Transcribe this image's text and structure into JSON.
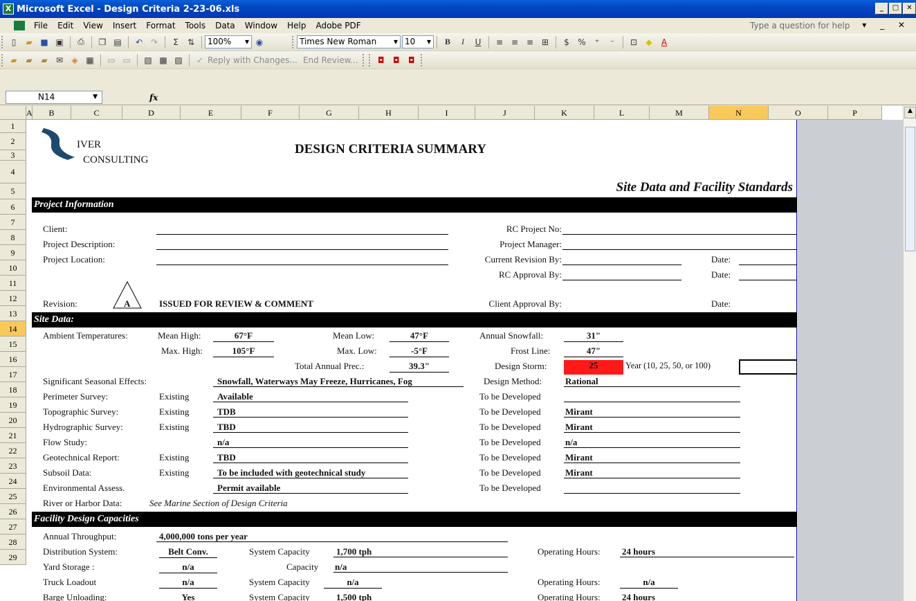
{
  "window": {
    "title": "Microsoft Excel - Design Criteria 2-23-06.xls",
    "buttons": [
      "_",
      "□",
      "✕"
    ]
  },
  "menu": {
    "items": [
      "File",
      "Edit",
      "View",
      "Insert",
      "Format",
      "Tools",
      "Data",
      "Window",
      "Help",
      "Adobe PDF"
    ],
    "ask_placeholder": "Type a question for help"
  },
  "toolbar": {
    "zoom": "100%",
    "font": "Times New Roman",
    "font_size": "10",
    "review": "Reply with Changes...",
    "end_review": "End Review..."
  },
  "formula_bar": {
    "cell_ref": "N14",
    "fx": "fx",
    "content": ""
  },
  "columns": [
    "A",
    "B",
    "C",
    "D",
    "E",
    "F",
    "G",
    "H",
    "I",
    "J",
    "K",
    "L",
    "M",
    "N",
    "O",
    "P"
  ],
  "rows": [
    "1",
    "2",
    "3",
    "4",
    "5",
    "6",
    "7",
    "8",
    "9",
    "10",
    "11",
    "12",
    "13",
    "14",
    "15",
    "16",
    "17",
    "18",
    "19",
    "20",
    "21",
    "22",
    "23",
    "24",
    "25",
    "26",
    "27",
    "28",
    "29"
  ],
  "sheet": {
    "logo": {
      "line1": "IVER",
      "line2": "CONSULTING"
    },
    "title": "DESIGN CRITERIA SUMMARY",
    "subtitle": "Site Data and Facility Standards",
    "sections": {
      "project": "Project Information",
      "site": "Site Data:",
      "facility": "Facility Design Capacities"
    },
    "project": {
      "client": "Client:",
      "description": "Project Description:",
      "location": "Project Location:",
      "revision_label": "Revision:",
      "revision_value": "A",
      "revision_text": "ISSUED FOR REVIEW & COMMENT",
      "rc_project_no": "RC Project No:",
      "project_manager": "Project Manager:",
      "current_revision_by": "Current Revision By:",
      "rc_approval_by": "RC Approval By:",
      "client_approval_by": "Client Approval By:",
      "date": "Date:"
    },
    "site": {
      "ambient": "Ambient Temperatures:",
      "mean_high_label": "Mean High:",
      "mean_high": "67°F",
      "max_high_label": "Max. High:",
      "max_high": "105°F",
      "mean_low_label": "Mean Low:",
      "mean_low": "47°F",
      "max_low_label": "Max. Low:",
      "max_low": "-5°F",
      "total_prec_label": "Total Annual Prec.:",
      "total_prec": "39.3\"",
      "snowfall_label": "Annual Snowfall:",
      "snowfall": "31\"",
      "frost_label": "Frost Line:",
      "frost": "47\"",
      "storm_label": "Design Storm:",
      "storm": "25",
      "storm_note": "Year (10, 25, 50, or 100)",
      "seasonal_label": "Significant Seasonal Effects:",
      "seasonal": "Snowfall, Waterways May Freeze, Hurricanes, Fog",
      "method_label": "Design Method:",
      "method": "Rational",
      "surveys": [
        {
          "label": "Perimeter Survey:",
          "status": "Existing",
          "value": "Available",
          "dev": "To be Developed",
          "dev_value": ""
        },
        {
          "label": "Topographic Survey:",
          "status": "Existing",
          "value": "TDB",
          "dev": "To be Developed",
          "dev_value": "Mirant"
        },
        {
          "label": "Hydrographic Survey:",
          "status": "Existing",
          "value": "TBD",
          "dev": "To be Developed",
          "dev_value": "Mirant"
        },
        {
          "label": "Flow Study:",
          "status": "",
          "value": "n/a",
          "dev": "To be Developed",
          "dev_value": "n/a"
        },
        {
          "label": "Geotechnical Report:",
          "status": "Existing",
          "value": "TBD",
          "dev": "To be Developed",
          "dev_value": "Mirant"
        },
        {
          "label": "Subsoil Data:",
          "status": "Existing",
          "value": "To be included with geotechnical study",
          "dev": "To be Developed",
          "dev_value": "Mirant"
        },
        {
          "label": "Environmental Assess.",
          "status": "",
          "value": "Permit available",
          "dev": "To be Developed",
          "dev_value": ""
        }
      ],
      "river_label": "River or Harbor Data:",
      "river": "See Marine Section of Design Criteria"
    },
    "facility": {
      "throughput_label": "Annual Throughput:",
      "throughput": "4,000,000 tons per year",
      "dist_label": "Distribution System:",
      "dist": "Belt Conv.",
      "sys_cap_label": "System Capacity",
      "sys_cap": "1,700 tph",
      "op_hours_label": "Operating Hours:",
      "op_hours": "24 hours",
      "yard_label": "Yard Storage :",
      "yard": "n/a",
      "cap_label": "Capacity",
      "yard_cap": "n/a",
      "truck_label": "Truck Loadout",
      "truck": "n/a",
      "truck_cap": "n/a",
      "truck_hours": "n/a",
      "barge_label": "Barge Unloading:",
      "barge": "Yes",
      "barge_cap": "1,500 tph",
      "barge_hours": "24 hours"
    }
  }
}
